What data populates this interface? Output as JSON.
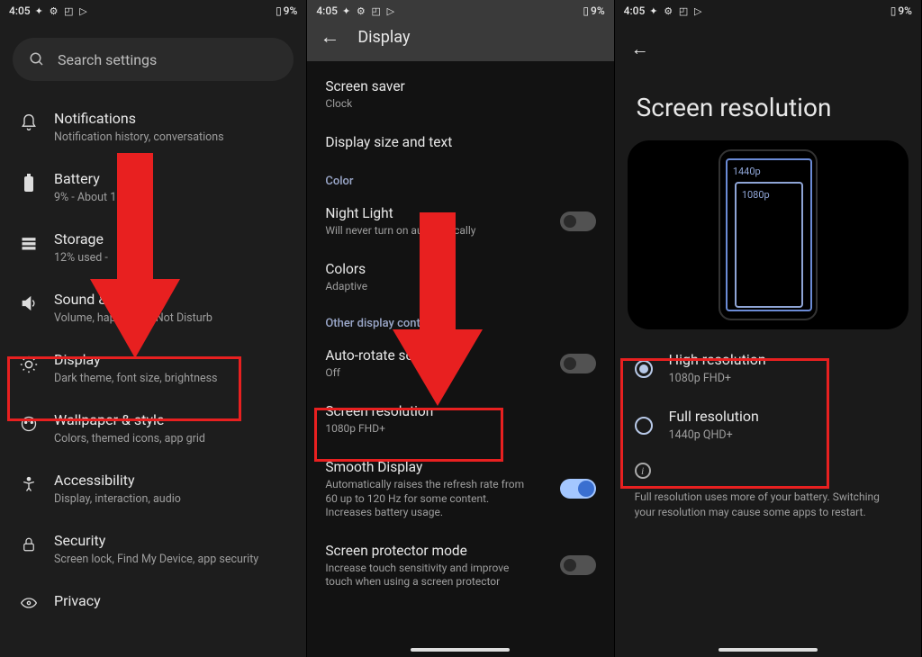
{
  "statusbar": {
    "time": "4:05",
    "battery_text": "9%"
  },
  "panel1": {
    "search_placeholder": "Search settings",
    "items": [
      {
        "title": "Notifications",
        "sub": "Notification history, conversations"
      },
      {
        "title": "Battery",
        "sub": "9% - About 1 hr,"
      },
      {
        "title": "Storage",
        "sub": "12% used -"
      },
      {
        "title": "Sound & vibration",
        "sub": "Volume, haptics, Do Not Disturb"
      },
      {
        "title": "Display",
        "sub": "Dark theme, font size, brightness"
      },
      {
        "title": "Wallpaper & style",
        "sub": "Colors, themed icons, app grid"
      },
      {
        "title": "Accessibility",
        "sub": "Display, interaction, audio"
      },
      {
        "title": "Security",
        "sub": "Screen lock, Find My Device, app security"
      },
      {
        "title": "Privacy",
        "sub": ""
      }
    ]
  },
  "panel2": {
    "header": "Display",
    "sections": {
      "top": [
        {
          "title": "Screen saver",
          "sub": "Clock"
        },
        {
          "title": "Display size and text",
          "sub": ""
        }
      ],
      "color_header": "Color",
      "color": [
        {
          "title": "Night Light",
          "sub": "Will never turn on automatically"
        },
        {
          "title": "Colors",
          "sub": "Adaptive"
        }
      ],
      "other_header": "Other display controls",
      "other": [
        {
          "title": "Auto-rotate screen",
          "sub": "Off"
        },
        {
          "title": "Screen resolution",
          "sub": "1080p FHD+"
        },
        {
          "title": "Smooth Display",
          "sub": "Automatically raises the refresh rate from 60 up to 120 Hz for some content. Increases battery usage."
        },
        {
          "title": "Screen protector mode",
          "sub": "Increase touch sensitivity and improve touch when using a screen protector"
        }
      ]
    }
  },
  "panel3": {
    "title": "Screen resolution",
    "preview": {
      "label_1440": "1440p",
      "label_1080": "1080p"
    },
    "options": [
      {
        "title": "High resolution",
        "sub": "1080p FHD+",
        "checked": true
      },
      {
        "title": "Full resolution",
        "sub": "1440p QHD+",
        "checked": false
      }
    ],
    "info": "Full resolution uses more of your battery. Switching your resolution may cause some apps to restart."
  }
}
